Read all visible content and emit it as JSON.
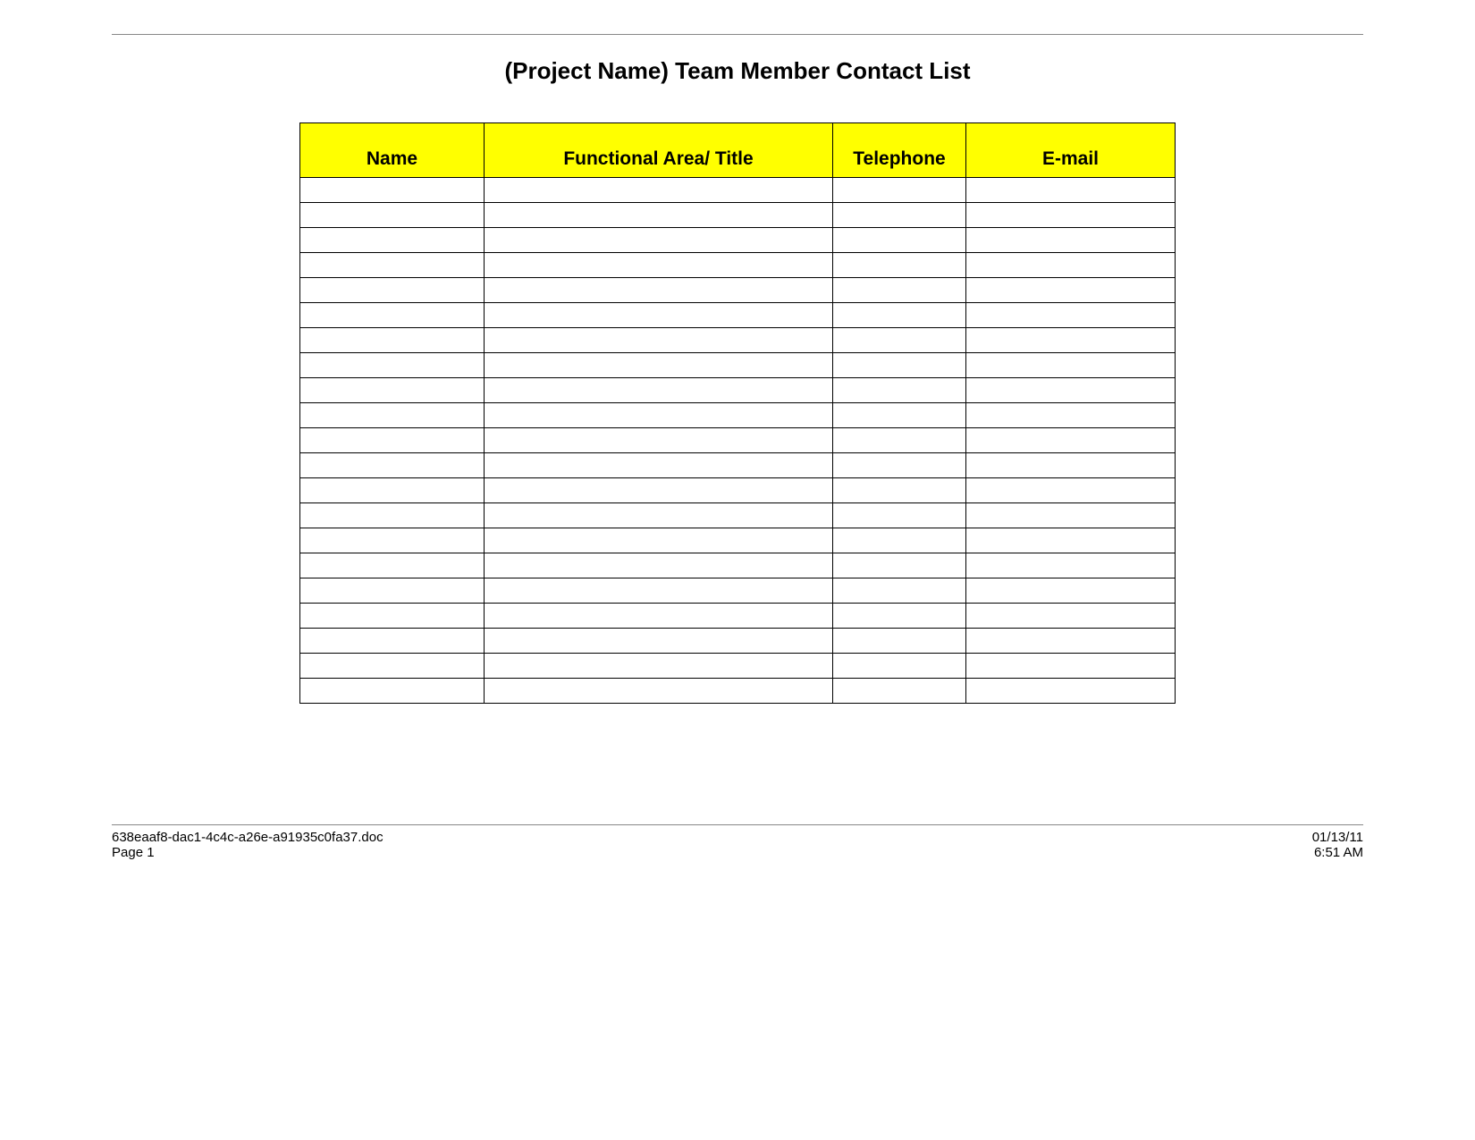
{
  "title": "(Project Name) Team Member Contact List",
  "columns": {
    "name": "Name",
    "area": "Functional Area/ Title",
    "phone": "Telephone",
    "email": "E-mail"
  },
  "rows": [
    {
      "name": "",
      "area": "",
      "phone": "",
      "email": ""
    },
    {
      "name": "",
      "area": "",
      "phone": "",
      "email": ""
    },
    {
      "name": "",
      "area": "",
      "phone": "",
      "email": ""
    },
    {
      "name": "",
      "area": "",
      "phone": "",
      "email": ""
    },
    {
      "name": "",
      "area": "",
      "phone": "",
      "email": ""
    },
    {
      "name": "",
      "area": "",
      "phone": "",
      "email": ""
    },
    {
      "name": "",
      "area": "",
      "phone": "",
      "email": ""
    },
    {
      "name": "",
      "area": "",
      "phone": "",
      "email": ""
    },
    {
      "name": "",
      "area": "",
      "phone": "",
      "email": ""
    },
    {
      "name": "",
      "area": "",
      "phone": "",
      "email": ""
    },
    {
      "name": "",
      "area": "",
      "phone": "",
      "email": ""
    },
    {
      "name": "",
      "area": "",
      "phone": "",
      "email": ""
    },
    {
      "name": "",
      "area": "",
      "phone": "",
      "email": ""
    },
    {
      "name": "",
      "area": "",
      "phone": "",
      "email": ""
    },
    {
      "name": "",
      "area": "",
      "phone": "",
      "email": ""
    },
    {
      "name": "",
      "area": "",
      "phone": "",
      "email": ""
    },
    {
      "name": "",
      "area": "",
      "phone": "",
      "email": ""
    },
    {
      "name": "",
      "area": "",
      "phone": "",
      "email": ""
    },
    {
      "name": "",
      "area": "",
      "phone": "",
      "email": ""
    },
    {
      "name": "",
      "area": "",
      "phone": "",
      "email": ""
    },
    {
      "name": "",
      "area": "",
      "phone": "",
      "email": ""
    }
  ],
  "footer": {
    "filename": "638eaaf8-dac1-4c4c-a26e-a91935c0fa37.doc",
    "page": "Page 1",
    "date": "01/13/11",
    "time": "6:51 AM"
  }
}
